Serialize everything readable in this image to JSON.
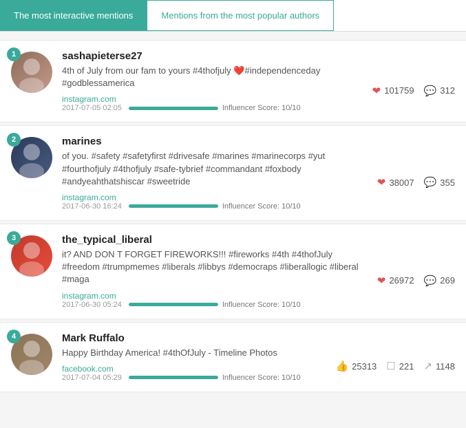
{
  "tabs": [
    {
      "id": "interactive",
      "label": "The most interactive mentions",
      "active": true
    },
    {
      "id": "popular",
      "label": "Mentions from the most popular authors",
      "active": false
    }
  ],
  "mentions": [
    {
      "rank": 1,
      "author": "sashapieterse27",
      "text": "4th of July from our fam to yours #4thofjuly ❤️#independenceday #godblessamerica",
      "source": "instagram.com",
      "date": "2017-07-05 02:05",
      "influencer_score": "Influencer Score: 10/10",
      "bar_percent": 100,
      "likes": "101759",
      "comments": "312",
      "shares": null,
      "avatar_class": "avatar-1"
    },
    {
      "rank": 2,
      "author": "marines",
      "text": "of you. #safety #safetyfirst #drivesafe #marines #marinecorps #yut #fourthofjuly #4thofjuly #safe-tybrief #commandant #foxbody #andyeahthatshiscar #sweetride",
      "source": "instagram.com",
      "date": "2017-06-30 16:24",
      "influencer_score": "Influencer Score: 10/10",
      "bar_percent": 100,
      "likes": "38007",
      "comments": "355",
      "shares": null,
      "avatar_class": "avatar-2"
    },
    {
      "rank": 3,
      "author": "the_typical_liberal",
      "text": "it? AND DON T FORGET FIREWORKS!!! #fireworks #4th #4thofJuly #freedom #trumpmemes #liberals #libbys #democraps #liberallogic #liberal #maga",
      "source": "instagram.com",
      "date": "2017-06-30 05:24",
      "influencer_score": "Influencer Score: 10/10",
      "bar_percent": 100,
      "likes": "26972",
      "comments": "269",
      "shares": null,
      "avatar_class": "avatar-3"
    },
    {
      "rank": 4,
      "author": "Mark Ruffalo",
      "text": "Happy Birthday America! #4thOfJuly - Timeline Photos",
      "source": "facebook.com",
      "date": "2017-07-04 05:29",
      "influencer_score": "Influencer Score: 10/10",
      "bar_percent": 100,
      "likes": "25313",
      "comments": "221",
      "shares": "1148",
      "avatar_class": "avatar-4"
    }
  ]
}
